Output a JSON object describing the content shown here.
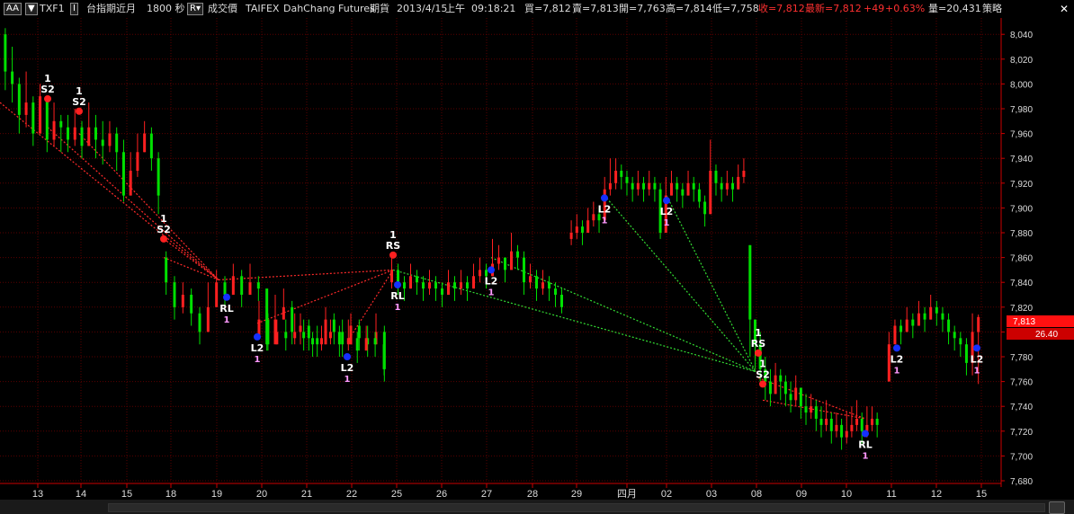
{
  "header": {
    "aa_label": "AA",
    "symbol": "TXF1",
    "name": "台指期近月",
    "period": "1800 秒",
    "price_type": "成交價",
    "exchange": "TAIFEX",
    "broker": "DahChang Futures",
    "category": "期貨",
    "date": "2013/4/15",
    "session": "上午",
    "time": "09:18:21",
    "bid": "買=7,812",
    "ask": "賣=7,813",
    "open": "開=7,763",
    "high": "高=7,814",
    "low": "低=7,758",
    "close": "收=7,812",
    "last": "最新=7,812",
    "change": "+49",
    "change_pct": "+0.63%",
    "volume": "量=20,431",
    "strategy": "策略"
  },
  "colors": {
    "up": "#ff2020",
    "down": "#00e000",
    "grid": "#5a0000",
    "axis": "#cc0000",
    "signal_red": "#ff2020",
    "signal_blue": "#1530ff",
    "trend_red": "#ff2a2a",
    "trend_green": "#33dd33"
  },
  "price_tag": "7,813",
  "small_tag": "26.40",
  "chart_data": {
    "type": "candlestick",
    "ylim": [
      7680,
      8050
    ],
    "y_ticks": [
      "7,680",
      "7,700",
      "7,720",
      "7,740",
      "7,760",
      "7,780",
      "7,800",
      "7,820",
      "7,840",
      "7,860",
      "7,880",
      "7,900",
      "7,920",
      "7,940",
      "7,960",
      "7,980",
      "8,000",
      "8,020",
      "8,040"
    ],
    "x_ticks": [
      "13",
      "14",
      "15",
      "18",
      "19",
      "20",
      "21",
      "22",
      "25",
      "26",
      "27",
      "28",
      "29",
      "四月",
      "02",
      "03",
      "08",
      "09",
      "10",
      "11",
      "12",
      "15"
    ],
    "segments": [
      {
        "start": [
          0,
          8040
        ],
        "points": [
          [
            8010,
            8045,
            7995
          ],
          [
            8000,
            8030,
            7985
          ],
          [
            7975,
            8005,
            7960
          ],
          [
            7985,
            8010,
            7965
          ],
          [
            7960,
            7990,
            7950
          ],
          [
            7990,
            8000,
            7960
          ],
          [
            7955,
            7985,
            7945
          ],
          [
            7970,
            7985,
            7950
          ],
          [
            7965,
            7975,
            7945
          ],
          [
            7955,
            7975,
            7945
          ],
          [
            7965,
            7980,
            7950
          ],
          [
            7950,
            7970,
            7940
          ],
          [
            7965,
            7985,
            7950
          ],
          [
            7955,
            7975,
            7940
          ],
          [
            7950,
            7970,
            7935
          ],
          [
            7960,
            7970,
            7945
          ],
          [
            7945,
            7965,
            7930
          ],
          [
            7910,
            7955,
            7905
          ],
          [
            7930,
            7945,
            7910
          ],
          [
            7945,
            7960,
            7925
          ],
          [
            7960,
            7970,
            7945
          ],
          [
            7940,
            7965,
            7930
          ],
          [
            7910,
            7945,
            7895
          ]
        ]
      },
      {
        "start": [
          7860,
          7860
        ],
        "points": [
          [
            7840,
            7865,
            7830
          ],
          [
            7820,
            7845,
            7810
          ],
          [
            7830,
            7840,
            7815
          ],
          [
            7815,
            7835,
            7805
          ],
          [
            7800,
            7820,
            7790
          ],
          [
            7820,
            7840,
            7810
          ],
          [
            7840,
            7850,
            7825
          ],
          [
            7830,
            7845,
            7820
          ],
          [
            7845,
            7855,
            7830
          ],
          [
            7830,
            7850,
            7820
          ],
          [
            7840,
            7855,
            7830
          ],
          [
            7835,
            7845,
            7825
          ],
          [
            7790,
            7830,
            7785
          ],
          [
            7810,
            7830,
            7800
          ],
          [
            7820,
            7835,
            7810
          ],
          [
            7800,
            7825,
            7790
          ],
          [
            7805,
            7815,
            7790
          ],
          [
            7795,
            7810,
            7785
          ],
          [
            7790,
            7805,
            7780
          ],
          [
            7810,
            7820,
            7790
          ],
          [
            7800,
            7815,
            7790
          ],
          [
            7790,
            7810,
            7780
          ],
          [
            7805,
            7815,
            7790
          ],
          [
            7795,
            7810,
            7785
          ],
          [
            7790,
            7805,
            7780
          ],
          [
            7800,
            7815,
            7790
          ],
          [
            7770,
            7805,
            7760
          ]
        ]
      },
      {
        "start": [
          7795,
          7795
        ],
        "points": [
          [
            7810,
            7825,
            7800
          ],
          [
            7790,
            7815,
            7785
          ],
          [
            7800,
            7810,
            7790
          ],
          [
            7795,
            7810,
            7785
          ],
          [
            7800,
            7815,
            7790
          ],
          [
            7795,
            7810,
            7785
          ],
          [
            7790,
            7800,
            7780
          ],
          [
            7795,
            7805,
            7785
          ],
          [
            7800,
            7810,
            7790
          ],
          [
            7790,
            7805,
            7780
          ],
          [
            7795,
            7810,
            7785
          ],
          [
            7785,
            7800,
            7775
          ],
          [
            7795,
            7805,
            7785
          ],
          [
            7790,
            7800,
            7780
          ],
          [
            7770,
            7795,
            7765
          ]
        ]
      },
      {
        "start": [
          7840,
          7840
        ],
        "points": [
          [
            7850,
            7860,
            7835
          ],
          [
            7840,
            7855,
            7830
          ],
          [
            7835,
            7845,
            7825
          ],
          [
            7845,
            7855,
            7835
          ],
          [
            7840,
            7850,
            7830
          ],
          [
            7835,
            7845,
            7825
          ],
          [
            7840,
            7850,
            7830
          ],
          [
            7835,
            7845,
            7825
          ],
          [
            7830,
            7840,
            7820
          ],
          [
            7840,
            7850,
            7830
          ],
          [
            7835,
            7845,
            7825
          ],
          [
            7840,
            7850,
            7830
          ],
          [
            7835,
            7845,
            7825
          ],
          [
            7845,
            7855,
            7835
          ],
          [
            7850,
            7860,
            7840
          ],
          [
            7845,
            7855,
            7835
          ],
          [
            7855,
            7875,
            7845
          ],
          [
            7860,
            7870,
            7850
          ],
          [
            7850,
            7860,
            7840
          ],
          [
            7865,
            7880,
            7855
          ],
          [
            7860,
            7870,
            7850
          ],
          [
            7840,
            7865,
            7830
          ],
          [
            7845,
            7855,
            7835
          ],
          [
            7835,
            7850,
            7825
          ],
          [
            7840,
            7850,
            7830
          ],
          [
            7835,
            7845,
            7825
          ],
          [
            7830,
            7840,
            7820
          ],
          [
            7820,
            7835,
            7815
          ]
        ]
      },
      {
        "start": [
          7875,
          7875
        ],
        "points": [
          [
            7880,
            7890,
            7870
          ],
          [
            7885,
            7895,
            7875
          ],
          [
            7880,
            7890,
            7870
          ],
          [
            7890,
            7900,
            7880
          ],
          [
            7895,
            7905,
            7885
          ],
          [
            7890,
            7900,
            7880
          ],
          [
            7915,
            7925,
            7905
          ],
          [
            7920,
            7940,
            7910
          ],
          [
            7930,
            7940,
            7915
          ],
          [
            7925,
            7935,
            7915
          ],
          [
            7920,
            7930,
            7910
          ],
          [
            7915,
            7925,
            7905
          ],
          [
            7920,
            7930,
            7910
          ],
          [
            7915,
            7925,
            7905
          ],
          [
            7920,
            7930,
            7910
          ],
          [
            7915,
            7925,
            7905
          ],
          [
            7880,
            7920,
            7875
          ],
          [
            7910,
            7925,
            7900
          ],
          [
            7920,
            7930,
            7910
          ],
          [
            7915,
            7925,
            7905
          ],
          [
            7910,
            7920,
            7900
          ],
          [
            7920,
            7930,
            7910
          ],
          [
            7915,
            7925,
            7905
          ],
          [
            7905,
            7920,
            7900
          ],
          [
            7895,
            7910,
            7885
          ],
          [
            7930,
            7955,
            7920
          ],
          [
            7920,
            7935,
            7910
          ],
          [
            7915,
            7925,
            7905
          ],
          [
            7920,
            7930,
            7910
          ],
          [
            7915,
            7925,
            7905
          ],
          [
            7925,
            7935,
            7915
          ],
          [
            7930,
            7940,
            7920
          ]
        ]
      },
      {
        "start": [
          7870,
          7870
        ],
        "points": [
          [
            7810,
            7870,
            7780
          ],
          [
            7790,
            7810,
            7770
          ],
          [
            7770,
            7800,
            7760
          ],
          [
            7760,
            7780,
            7745
          ],
          [
            7750,
            7770,
            7740
          ],
          [
            7765,
            7775,
            7750
          ],
          [
            7760,
            7770,
            7745
          ],
          [
            7750,
            7765,
            7740
          ],
          [
            7745,
            7760,
            7735
          ],
          [
            7755,
            7765,
            7740
          ],
          [
            7740,
            7755,
            7730
          ],
          [
            7735,
            7750,
            7725
          ],
          [
            7740,
            7750,
            7730
          ],
          [
            7730,
            7745,
            7720
          ],
          [
            7725,
            7740,
            7715
          ],
          [
            7730,
            7745,
            7720
          ],
          [
            7720,
            7735,
            7710
          ],
          [
            7725,
            7735,
            7715
          ],
          [
            7715,
            7730,
            7705
          ],
          [
            7720,
            7735,
            7710
          ],
          [
            7725,
            7740,
            7715
          ],
          [
            7730,
            7745,
            7720
          ],
          [
            7720,
            7735,
            7710
          ],
          [
            7725,
            7740,
            7715
          ],
          [
            7730,
            7740,
            7720
          ],
          [
            7725,
            7735,
            7715
          ]
        ]
      },
      {
        "start": [
          7760,
          7760
        ],
        "points": [
          [
            7790,
            7800,
            7760
          ],
          [
            7805,
            7810,
            7790
          ],
          [
            7800,
            7810,
            7790
          ],
          [
            7810,
            7820,
            7800
          ],
          [
            7805,
            7815,
            7795
          ],
          [
            7815,
            7825,
            7805
          ],
          [
            7810,
            7820,
            7800
          ],
          [
            7820,
            7830,
            7810
          ],
          [
            7815,
            7825,
            7805
          ],
          [
            7810,
            7820,
            7800
          ],
          [
            7800,
            7815,
            7790
          ],
          [
            7795,
            7805,
            7785
          ],
          [
            7790,
            7800,
            7780
          ],
          [
            7775,
            7795,
            7765
          ],
          [
            7800,
            7815,
            7765
          ],
          [
            7812,
            7814,
            7758
          ]
        ]
      }
    ],
    "signals": [
      {
        "label": "S2",
        "num": "1",
        "x": 53,
        "y": 7988,
        "color": "red",
        "num_above": true
      },
      {
        "label": "S2",
        "num": "1",
        "x": 88,
        "y": 7978,
        "color": "red",
        "num_above": true
      },
      {
        "label": "S2",
        "num": "1",
        "x": 182,
        "y": 7875,
        "color": "red",
        "num_above": true
      },
      {
        "label": "RL",
        "num": "1",
        "x": 252,
        "y": 7828,
        "color": "blue",
        "num_above": false
      },
      {
        "label": "L2",
        "num": "1",
        "x": 286,
        "y": 7796,
        "color": "blue",
        "num_above": false
      },
      {
        "label": "L2",
        "num": "1",
        "x": 386,
        "y": 7780,
        "color": "blue",
        "num_above": false
      },
      {
        "label": "RS",
        "num": "1",
        "x": 437,
        "y": 7862,
        "color": "red",
        "num_above": true
      },
      {
        "label": "RL",
        "num": "1",
        "x": 442,
        "y": 7838,
        "color": "blue",
        "num_above": false
      },
      {
        "label": "L2",
        "num": "1",
        "x": 546,
        "y": 7850,
        "color": "blue",
        "num_above": false
      },
      {
        "label": "L2",
        "num": "1",
        "x": 672,
        "y": 7908,
        "color": "blue",
        "num_above": false
      },
      {
        "label": "L2",
        "num": "1",
        "x": 741,
        "y": 7906,
        "color": "blue",
        "num_above": false
      },
      {
        "label": "RS",
        "num": "1",
        "x": 843,
        "y": 7783,
        "color": "red",
        "num_above": true
      },
      {
        "label": "S2",
        "num": "1",
        "x": 848,
        "y": 7758,
        "color": "red",
        "num_above": true
      },
      {
        "label": "RL",
        "num": "1",
        "x": 962,
        "y": 7718,
        "color": "blue",
        "num_above": false
      },
      {
        "label": "L2",
        "num": "1",
        "x": 997,
        "y": 7787,
        "color": "blue",
        "num_above": false
      },
      {
        "label": "L2",
        "num": "1",
        "x": 1086,
        "y": 7787,
        "color": "blue",
        "num_above": false
      }
    ],
    "trend_lines": [
      {
        "color": "red",
        "from": [
          0,
          7985
        ],
        "to": [
          243,
          7842
        ]
      },
      {
        "color": "red",
        "from": [
          53,
          7965
        ],
        "to": [
          243,
          7842
        ]
      },
      {
        "color": "red",
        "from": [
          88,
          7960
        ],
        "to": [
          243,
          7842
        ]
      },
      {
        "color": "red",
        "from": [
          182,
          7875
        ],
        "to": [
          243,
          7842
        ]
      },
      {
        "color": "red",
        "from": [
          182,
          7860
        ],
        "to": [
          243,
          7842
        ]
      },
      {
        "color": "red",
        "from": [
          243,
          7842
        ],
        "to": [
          437,
          7850
        ]
      },
      {
        "color": "red",
        "from": [
          286,
          7807
        ],
        "to": [
          437,
          7850
        ]
      },
      {
        "color": "red",
        "from": [
          386,
          7792
        ],
        "to": [
          437,
          7850
        ]
      },
      {
        "color": "green",
        "from": [
          437,
          7850
        ],
        "to": [
          840,
          7768
        ]
      },
      {
        "color": "green",
        "from": [
          546,
          7860
        ],
        "to": [
          840,
          7768
        ]
      },
      {
        "color": "green",
        "from": [
          672,
          7910
        ],
        "to": [
          840,
          7768
        ]
      },
      {
        "color": "green",
        "from": [
          741,
          7910
        ],
        "to": [
          840,
          7768
        ]
      },
      {
        "color": "red",
        "from": [
          843,
          7763
        ],
        "to": [
          962,
          7730
        ]
      },
      {
        "color": "red",
        "from": [
          848,
          7745
        ],
        "to": [
          962,
          7730
        ]
      }
    ]
  }
}
